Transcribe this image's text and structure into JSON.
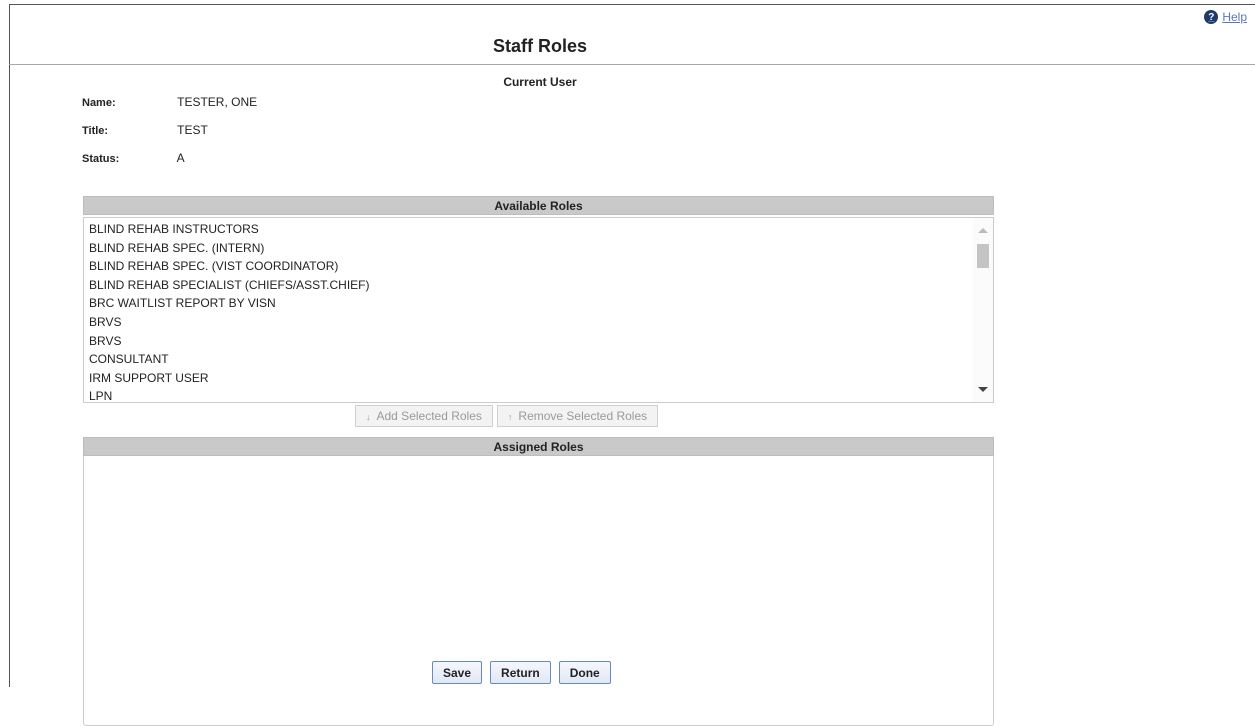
{
  "help": {
    "label": "Help",
    "icon": "question-circle-icon"
  },
  "page": {
    "title": "Staff Roles"
  },
  "current_user": {
    "heading": "Current User",
    "name_label": "Name:",
    "name_value": "TESTER, ONE",
    "title_label": "Title:",
    "title_value": "TEST",
    "status_label": "Status:",
    "status_value": "A"
  },
  "available_roles": {
    "header": "Available Roles",
    "items": [
      "BLIND REHAB INSTRUCTORS",
      "BLIND REHAB SPEC. (INTERN)",
      "BLIND REHAB SPEC. (VIST COORDINATOR)",
      "BLIND REHAB SPECIALIST (CHIEFS/ASST.CHIEF)",
      "BRC WAITLIST REPORT BY VISN",
      "BRVS",
      "BRVS",
      "CONSULTANT",
      "IRM SUPPORT USER",
      "LPN"
    ]
  },
  "move_buttons": {
    "add_label": "Add Selected Roles",
    "add_arrow": "↓",
    "remove_label": "Remove Selected Roles",
    "remove_arrow": "↑"
  },
  "assigned_roles": {
    "header": "Assigned Roles",
    "items": []
  },
  "actions": {
    "save": "Save",
    "return": "Return",
    "done": "Done"
  },
  "colors": {
    "panel_header_bg": "#c9c9c9",
    "help_link": "#5577bb",
    "button_border": "#6d89b8",
    "disabled_text": "#9a9a9a"
  }
}
